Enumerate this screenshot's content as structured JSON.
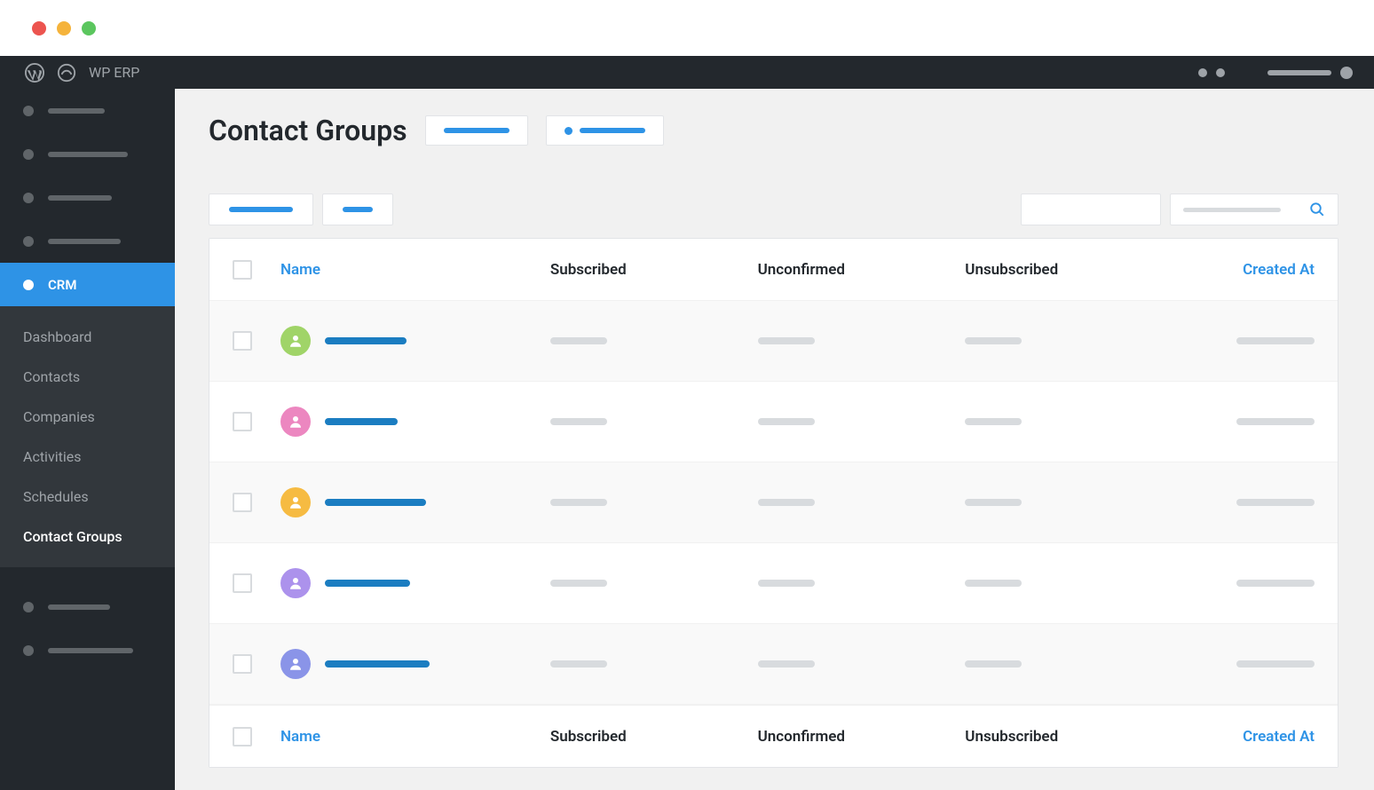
{
  "topbar": {
    "app_name": "WP ERP"
  },
  "sidebar": {
    "crm_label": "CRM",
    "sub": {
      "dashboard": "Dashboard",
      "contacts": "Contacts",
      "companies": "Companies",
      "activities": "Activities",
      "schedules": "Schedules",
      "contact_groups": "Contact Groups"
    }
  },
  "page": {
    "title": "Contact Groups"
  },
  "table": {
    "headers": {
      "name": "Name",
      "subscribed": "Subscribed",
      "unconfirmed": "Unconfirmed",
      "unsubscribed": "Unsubscribed",
      "created_at": "Created At"
    },
    "rows": [
      {
        "avatar_color": "av-green",
        "name_w": 92,
        "alt": true
      },
      {
        "avatar_color": "av-pink",
        "name_w": 82,
        "alt": false
      },
      {
        "avatar_color": "av-orange",
        "name_w": 114,
        "alt": true
      },
      {
        "avatar_color": "av-purple",
        "name_w": 96,
        "alt": false
      },
      {
        "avatar_color": "av-blue",
        "name_w": 118,
        "alt": true
      }
    ]
  }
}
